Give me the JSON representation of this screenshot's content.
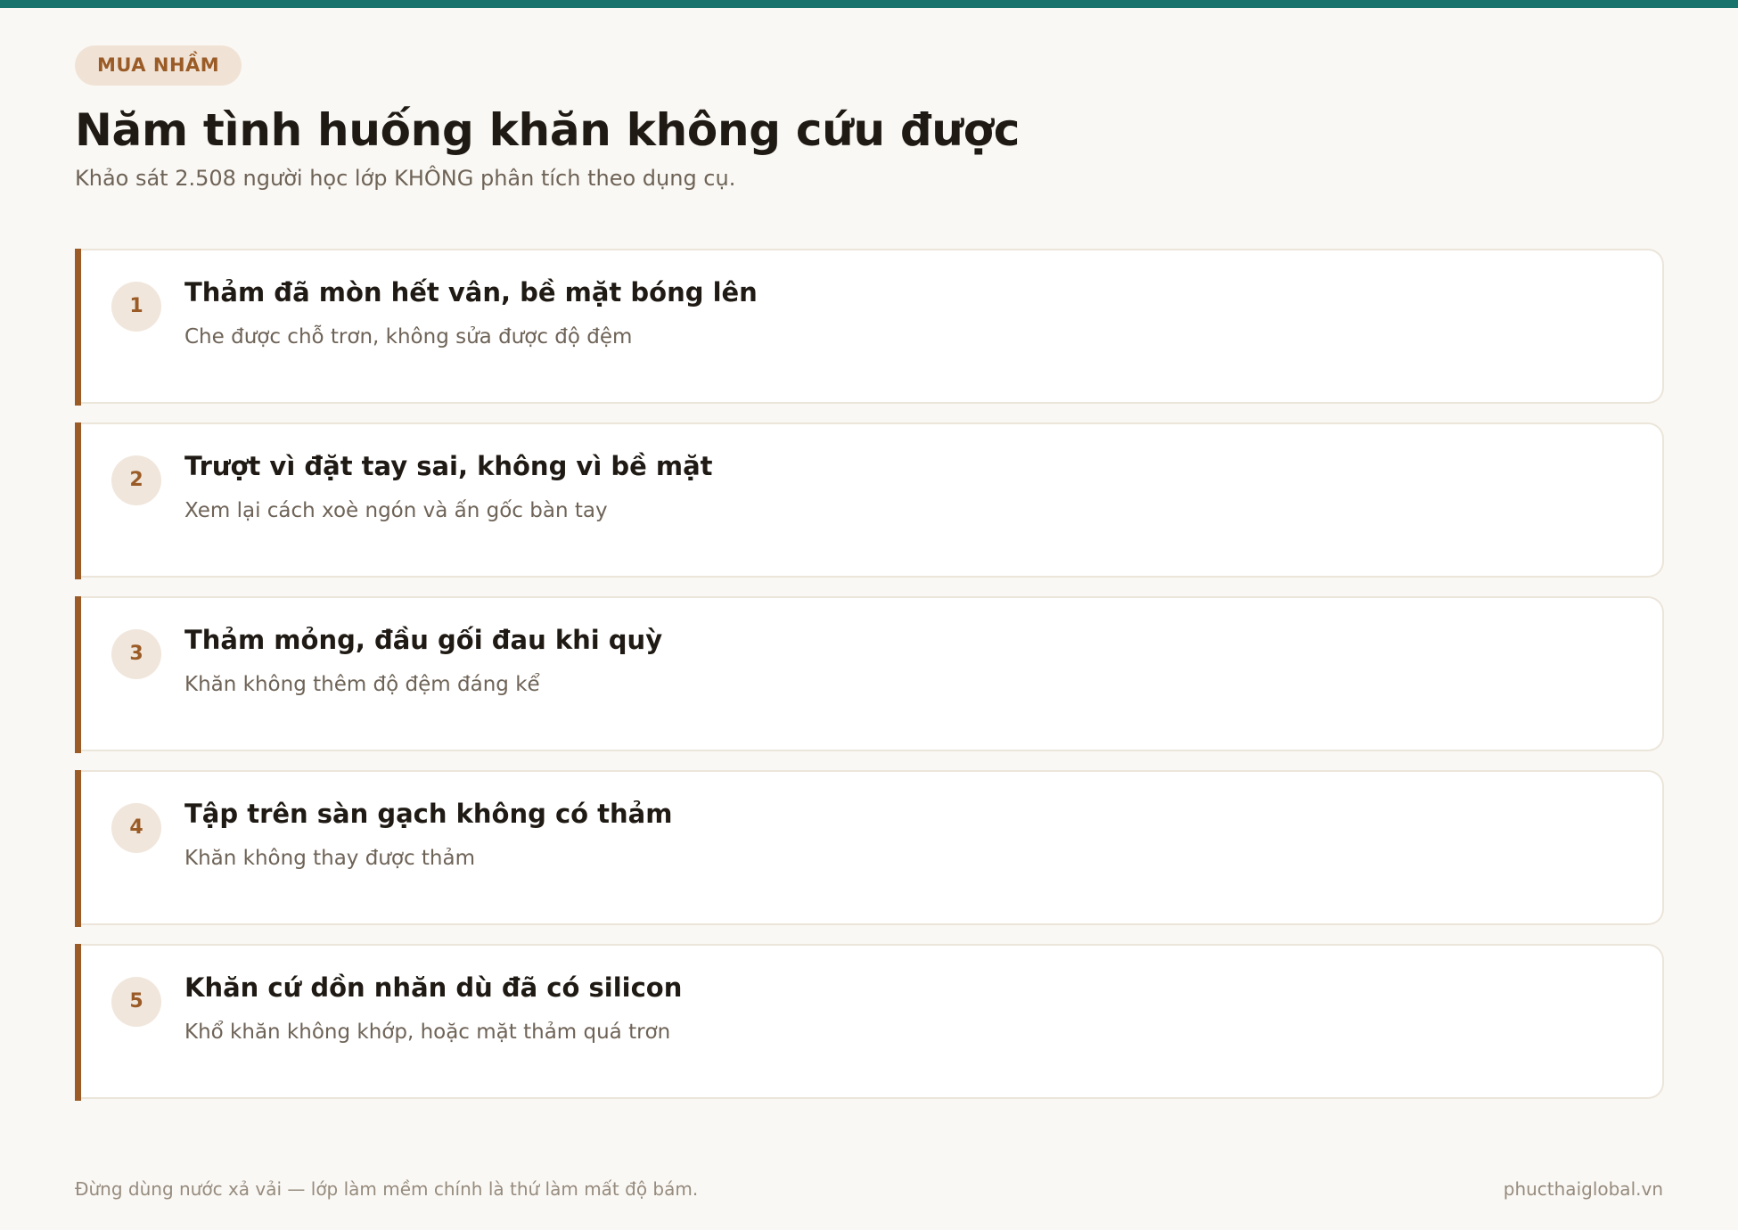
{
  "header": {
    "tag": "MUA NHẦM",
    "title": "Năm tình huống khăn không cứu được",
    "subtitle": "Khảo sát 2.508 người học lớp KHÔNG phân tích theo dụng cụ."
  },
  "items": [
    {
      "number": "1",
      "title": "Thảm đã mòn hết vân, bề mặt bóng lên",
      "description": "Che được chỗ trơn, không sửa được độ đệm"
    },
    {
      "number": "2",
      "title": "Trượt vì đặt tay sai, không vì bề mặt",
      "description": "Xem lại cách xoè ngón và ấn gốc bàn tay"
    },
    {
      "number": "3",
      "title": "Thảm mỏng, đầu gối đau khi quỳ",
      "description": "Khăn không thêm độ đệm đáng kể"
    },
    {
      "number": "4",
      "title": "Tập trên sàn gạch không có thảm",
      "description": "Khăn không thay được thảm"
    },
    {
      "number": "5",
      "title": "Khăn cứ dồn nhăn dù đã có silicon",
      "description": "Khổ khăn không khớp, hoặc mặt thảm quá trơn"
    }
  ],
  "footer": {
    "note": "Đừng dùng nước xả vải — lớp làm mềm chính là thứ làm mất độ bám.",
    "site": "phucthaiglobal.vn"
  },
  "colors": {
    "top_bar": "#17736b",
    "accent": "#9a5b26",
    "background": "#faf8f4"
  }
}
